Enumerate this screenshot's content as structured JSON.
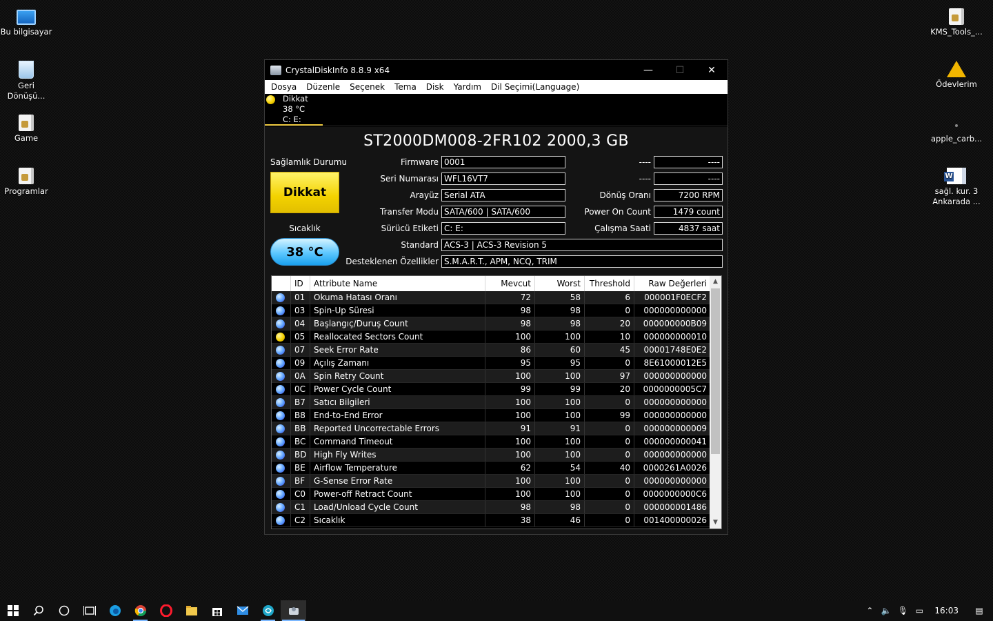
{
  "desktop": {
    "left_icons": [
      {
        "label": "Bu bilgisayar",
        "icon": "computer-icon"
      },
      {
        "label": "Geri Dönüşü...",
        "icon": "recycle-bin-icon"
      },
      {
        "label": "Game",
        "icon": "folder-icon"
      },
      {
        "label": "Programlar",
        "icon": "folder-icon"
      }
    ],
    "right_icons": [
      {
        "label": "KMS_Tools_...",
        "icon": "file-icon"
      },
      {
        "label": "Ödevlerim",
        "icon": "warning-icon"
      },
      {
        "label": "apple_carb...",
        "icon": "file-icon"
      },
      {
        "label": "sağl. kur. 3 Ankarada ...",
        "icon": "word-document-icon"
      }
    ]
  },
  "window": {
    "title": "CrystalDiskInfo 8.8.9 x64",
    "controls": {
      "minimize": "—",
      "maximize": "☐",
      "close": "✕"
    }
  },
  "menu": [
    "Dosya",
    "Düzenle",
    "Seçenek",
    "Tema",
    "Disk",
    "Yardım",
    "Dil Seçimi(Language)"
  ],
  "disk_tab": {
    "status": "Dikkat",
    "temp": "38 °C",
    "drives": "C: E:"
  },
  "drive": {
    "model": "ST2000DM008-2FR102 2000,3 GB",
    "health_label": "Sağlamlık Durumu",
    "health_value": "Dikkat",
    "temp_label": "Sıcaklık",
    "temp_value": "38 °C",
    "firmware_label": "Firmware",
    "firmware": "0001",
    "serial_label": "Seri Numarası",
    "serial": "WFL16VT7",
    "interface_label": "Arayüz",
    "interface": "Serial ATA",
    "transfer_label": "Transfer Modu",
    "transfer": "SATA/600 | SATA/600",
    "letter_label": "Sürücü Etiketi",
    "letter": "C: E:",
    "standard_label": "Standard",
    "standard": "ACS-3 | ACS-3 Revision 5",
    "features_label": "Desteklenen Özellikler",
    "features": "S.M.A.R.T., APM, NCQ, TRIM",
    "blank1_label": "----",
    "blank1": "----",
    "blank2_label": "----",
    "blank2": "----",
    "rotation_label": "Dönüş Oranı",
    "rotation": "7200 RPM",
    "power_on_count_label": "Power On Count",
    "power_on_count": "1479 count",
    "hours_label": "Çalışma Saati",
    "hours": "4837 saat"
  },
  "smart": {
    "headers": [
      "",
      "ID",
      "Attribute Name",
      "Mevcut",
      "Worst",
      "Threshold",
      "Raw Değerleri"
    ],
    "rows": [
      {
        "status": "good",
        "id": "01",
        "name": "Okuma Hatası Oranı",
        "cur": "72",
        "worst": "58",
        "thr": "6",
        "raw": "000001F0ECF2"
      },
      {
        "status": "good",
        "id": "03",
        "name": "Spin-Up Süresi",
        "cur": "98",
        "worst": "98",
        "thr": "0",
        "raw": "000000000000"
      },
      {
        "status": "good",
        "id": "04",
        "name": "Başlangıç/Duruş Count",
        "cur": "98",
        "worst": "98",
        "thr": "20",
        "raw": "000000000B09"
      },
      {
        "status": "caution",
        "id": "05",
        "name": "Reallocated Sectors Count",
        "cur": "100",
        "worst": "100",
        "thr": "10",
        "raw": "000000000010"
      },
      {
        "status": "good",
        "id": "07",
        "name": "Seek Error Rate",
        "cur": "86",
        "worst": "60",
        "thr": "45",
        "raw": "00001748E0E2"
      },
      {
        "status": "good",
        "id": "09",
        "name": "Açılış Zamanı",
        "cur": "95",
        "worst": "95",
        "thr": "0",
        "raw": "8E61000012E5"
      },
      {
        "status": "good",
        "id": "0A",
        "name": "Spin Retry Count",
        "cur": "100",
        "worst": "100",
        "thr": "97",
        "raw": "000000000000"
      },
      {
        "status": "good",
        "id": "0C",
        "name": "Power Cycle Count",
        "cur": "99",
        "worst": "99",
        "thr": "20",
        "raw": "0000000005C7"
      },
      {
        "status": "good",
        "id": "B7",
        "name": "Satıcı Bilgileri",
        "cur": "100",
        "worst": "100",
        "thr": "0",
        "raw": "000000000000"
      },
      {
        "status": "good",
        "id": "B8",
        "name": "End-to-End Error",
        "cur": "100",
        "worst": "100",
        "thr": "99",
        "raw": "000000000000"
      },
      {
        "status": "good",
        "id": "BB",
        "name": "Reported Uncorrectable Errors",
        "cur": "91",
        "worst": "91",
        "thr": "0",
        "raw": "000000000009"
      },
      {
        "status": "good",
        "id": "BC",
        "name": "Command Timeout",
        "cur": "100",
        "worst": "100",
        "thr": "0",
        "raw": "000000000041"
      },
      {
        "status": "good",
        "id": "BD",
        "name": "High Fly Writes",
        "cur": "100",
        "worst": "100",
        "thr": "0",
        "raw": "000000000000"
      },
      {
        "status": "good",
        "id": "BE",
        "name": "Airflow Temperature",
        "cur": "62",
        "worst": "54",
        "thr": "40",
        "raw": "0000261A0026"
      },
      {
        "status": "good",
        "id": "BF",
        "name": "G-Sense Error Rate",
        "cur": "100",
        "worst": "100",
        "thr": "0",
        "raw": "000000000000"
      },
      {
        "status": "good",
        "id": "C0",
        "name": "Power-off Retract Count",
        "cur": "100",
        "worst": "100",
        "thr": "0",
        "raw": "0000000000C6"
      },
      {
        "status": "good",
        "id": "C1",
        "name": "Load/Unload Cycle Count",
        "cur": "98",
        "worst": "98",
        "thr": "0",
        "raw": "000000001486"
      },
      {
        "status": "good",
        "id": "C2",
        "name": "Sıcaklık",
        "cur": "38",
        "worst": "46",
        "thr": "0",
        "raw": "001400000026"
      }
    ]
  },
  "taskbar": {
    "apps": [
      "start-icon",
      "search-icon",
      "cortana-icon",
      "task-view-icon",
      "edge-icon",
      "chrome-icon",
      "opera-icon",
      "file-explorer-icon",
      "store-icon",
      "mail-icon",
      "app-icon",
      "crystaldiskinfo-icon"
    ],
    "clock": "16:03"
  },
  "colors": {
    "caution": "#f5d000",
    "good": "#5aa0ff",
    "temp": "#5cc7ff"
  }
}
